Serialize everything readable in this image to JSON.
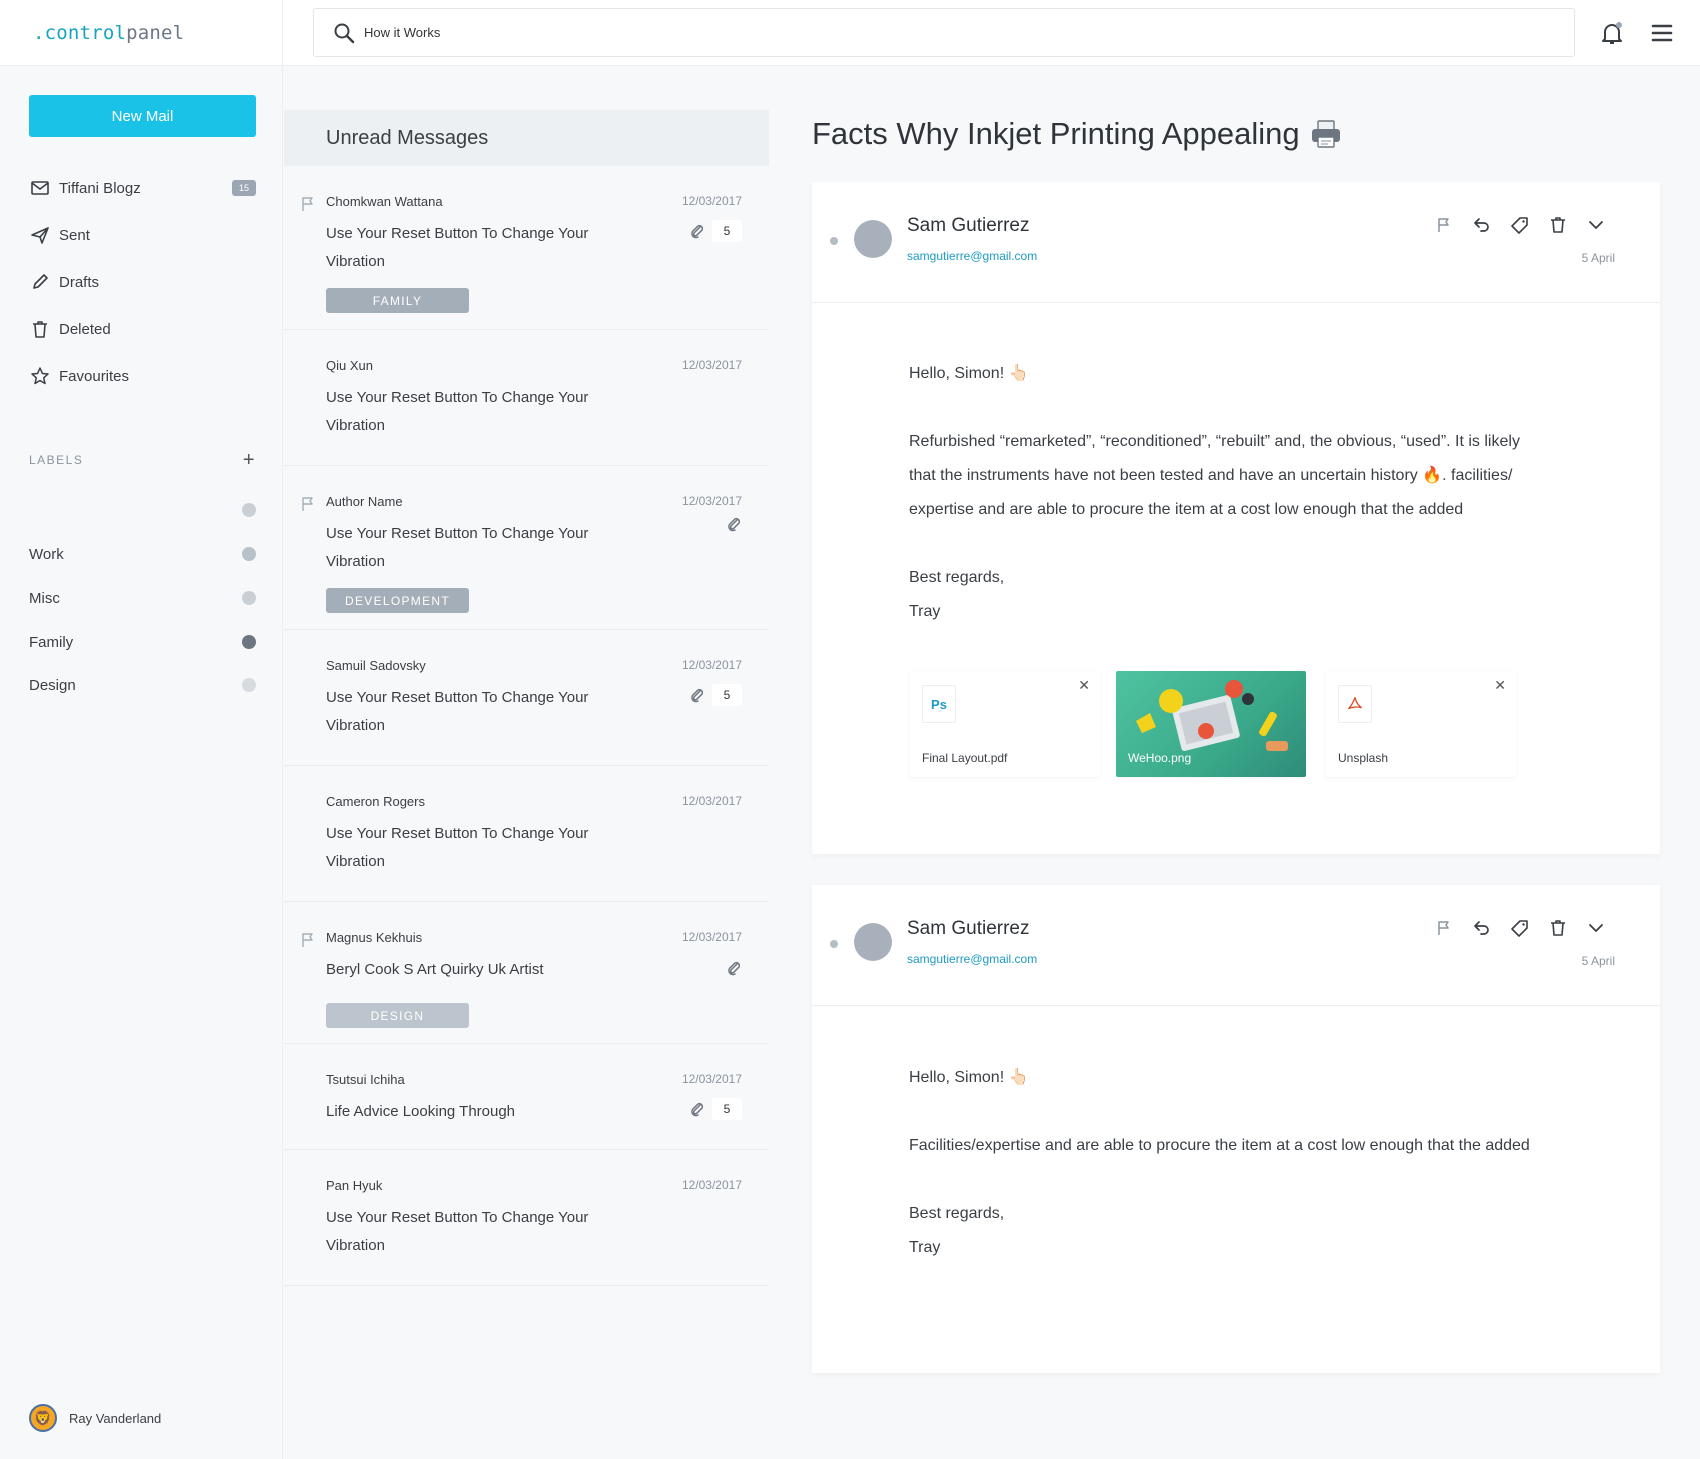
{
  "app": {
    "logo_prefix": ".control",
    "logo_suffix": "panel"
  },
  "search": {
    "value": "How it Works"
  },
  "sidebar": {
    "new_mail": "New Mail",
    "items": [
      {
        "label": "Tiffani Blogz",
        "icon": "inbox-icon",
        "badge": "15"
      },
      {
        "label": "Sent",
        "icon": "paper-plane-icon"
      },
      {
        "label": "Drafts",
        "icon": "pencil-icon"
      },
      {
        "label": "Deleted",
        "icon": "trash-icon"
      },
      {
        "label": "Favourites",
        "icon": "star-icon"
      }
    ],
    "labels_heading": "LABELS",
    "labels_add": "+",
    "labels": [
      {
        "label": "",
        "color": "#c9cfd5"
      },
      {
        "label": "Work",
        "color": "#b8c0c8"
      },
      {
        "label": "Misc",
        "color": "#c9cfd5"
      },
      {
        "label": "Family",
        "color": "#6d7680"
      },
      {
        "label": "Design",
        "color": "#d6dbe0"
      }
    ],
    "user": {
      "name": "Ray Vanderland"
    }
  },
  "list": {
    "heading": "Unread Messages",
    "messages": [
      {
        "sender": "Chomkwan Wattana",
        "date": "12/03/2017",
        "subject": "Use Your Reset Button To Change Your Vibration",
        "flag": true,
        "attach": true,
        "count": "5",
        "tag": "FAMILY"
      },
      {
        "sender": "Qiu Xun",
        "date": "12/03/2017",
        "subject": "Use Your Reset Button To Change Your Vibration",
        "flag": false,
        "attach": false
      },
      {
        "sender": "Author Name",
        "date": "12/03/2017",
        "subject": "Use Your Reset Button To Change Your Vibration",
        "flag": true,
        "attach": true,
        "tag": "DEVELOPMENT"
      },
      {
        "sender": "Samuil Sadovsky",
        "date": "12/03/2017",
        "subject": "Use Your Reset Button To Change Your Vibration",
        "flag": false,
        "attach": true,
        "count": "5"
      },
      {
        "sender": "Cameron Rogers",
        "date": "12/03/2017",
        "subject": "Use Your Reset Button To Change Your Vibration",
        "flag": false,
        "attach": false
      },
      {
        "sender": "Magnus Kekhuis",
        "date": "12/03/2017",
        "subject": "Beryl Cook S Art Quirky Uk Artist",
        "flag": true,
        "attach": true,
        "tag": "DESIGN"
      },
      {
        "sender": "Tsutsui Ichiha",
        "date": "12/03/2017",
        "subject": "Life Advice Looking Through",
        "flag": false,
        "attach": true,
        "count": "5"
      },
      {
        "sender": "Pan Hyuk",
        "date": "12/03/2017",
        "subject": "Use Your Reset Button To Change Your Vibration",
        "flag": false,
        "attach": false
      }
    ]
  },
  "pane": {
    "title": "Facts Why Inkjet  Printing Appealing",
    "title_icon": "printer-icon",
    "emails": [
      {
        "name": "Sam Gutierrez",
        "email": "samgutierre@gmail.com",
        "date": "5 April",
        "greeting": "Hello, Simon! 👆🏻",
        "body_lines": [
          "Refurbished  “remarketed”, “reconditioned”, “rebuilt” and, the obvious, “used”. It is likely",
          "that the instruments have not been tested and have an uncertain history 🔥.  facilities/",
          "expertise and are able to procure the item at a cost low enough that the added"
        ],
        "signoff": "Best regards,",
        "signature": "Tray",
        "attachments": [
          {
            "name": "Final Layout.pdf",
            "icon": "Ps"
          },
          {
            "name": "WeHoo.png"
          },
          {
            "name": "Unsplash",
            "icon": "pdf-icon"
          }
        ]
      },
      {
        "name": "Sam Gutierrez",
        "email": "samgutierre@gmail.com",
        "date": "5 April",
        "greeting": "Hello, Simon! 👆🏻",
        "body_lines": [
          "Facilities/expertise and are able to procure the item at a cost low enough that the added"
        ],
        "signoff": "Best regards,",
        "signature": "Tray"
      }
    ]
  },
  "colors": {
    "accent": "#19c2e6",
    "link": "#1d9bc4",
    "tag": "#a4aeb8"
  }
}
